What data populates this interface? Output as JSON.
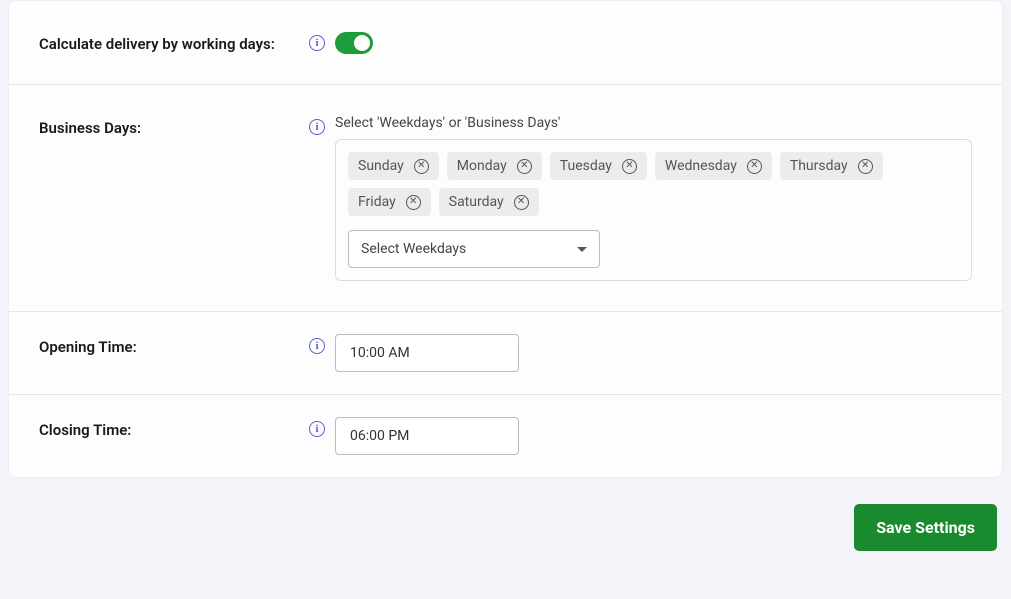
{
  "settings": {
    "workingDays": {
      "label": "Calculate delivery by working days:",
      "enabled": true
    },
    "businessDays": {
      "label": "Business Days:",
      "helper": "Select 'Weekdays' or 'Business Days'",
      "chips": [
        "Sunday",
        "Monday",
        "Tuesday",
        "Wednesday",
        "Thursday",
        "Friday",
        "Saturday"
      ],
      "selectPlaceholder": "Select Weekdays"
    },
    "openingTime": {
      "label": "Opening Time:",
      "value": "10:00 AM"
    },
    "closingTime": {
      "label": "Closing Time:",
      "value": "06:00 PM"
    }
  },
  "actions": {
    "save": "Save Settings"
  }
}
